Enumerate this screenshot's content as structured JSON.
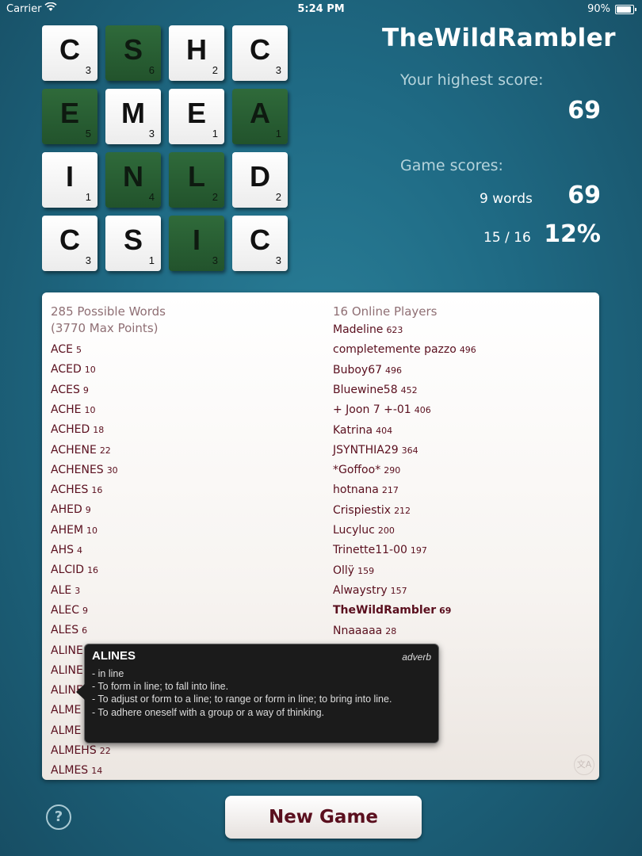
{
  "status_bar": {
    "carrier": "Carrier",
    "time": "5:24 PM",
    "battery": "90%"
  },
  "board": [
    {
      "letter": "C",
      "points": "3",
      "color": "white"
    },
    {
      "letter": "S",
      "points": "6",
      "color": "green"
    },
    {
      "letter": "H",
      "points": "2",
      "color": "white"
    },
    {
      "letter": "C",
      "points": "3",
      "color": "white"
    },
    {
      "letter": "E",
      "points": "5",
      "color": "green"
    },
    {
      "letter": "M",
      "points": "3",
      "color": "white"
    },
    {
      "letter": "E",
      "points": "1",
      "color": "white"
    },
    {
      "letter": "A",
      "points": "1",
      "color": "green"
    },
    {
      "letter": "I",
      "points": "1",
      "color": "white"
    },
    {
      "letter": "N",
      "points": "4",
      "color": "green"
    },
    {
      "letter": "L",
      "points": "2",
      "color": "green"
    },
    {
      "letter": "D",
      "points": "2",
      "color": "white"
    },
    {
      "letter": "C",
      "points": "3",
      "color": "white"
    },
    {
      "letter": "S",
      "points": "1",
      "color": "white"
    },
    {
      "letter": "I",
      "points": "3",
      "color": "green"
    },
    {
      "letter": "C",
      "points": "3",
      "color": "white"
    }
  ],
  "profile": {
    "username": "TheWildRambler",
    "highest_label": "Your highest score:",
    "highest_value": "69",
    "game_scores_label": "Game scores:",
    "words_count": "9 words",
    "game_score": "69",
    "found_ratio": "15 / 16",
    "percent": "12%"
  },
  "words_panel": {
    "title": "285 Possible Words",
    "subtitle": "(3770 Max Points)",
    "words": [
      {
        "word": "ACE",
        "points": "5"
      },
      {
        "word": "ACED",
        "points": "10"
      },
      {
        "word": "ACES",
        "points": "9"
      },
      {
        "word": "ACHE",
        "points": "10"
      },
      {
        "word": "ACHED",
        "points": "18"
      },
      {
        "word": "ACHENE",
        "points": "22"
      },
      {
        "word": "ACHENES",
        "points": "30"
      },
      {
        "word": "ACHES",
        "points": "16"
      },
      {
        "word": "AHED",
        "points": "9"
      },
      {
        "word": "AHEM",
        "points": "10"
      },
      {
        "word": "AHS",
        "points": "4"
      },
      {
        "word": "ALCID",
        "points": "16"
      },
      {
        "word": "ALE",
        "points": "3"
      },
      {
        "word": "ALEC",
        "points": "9"
      },
      {
        "word": "ALES",
        "points": "6"
      },
      {
        "word": "ALINE",
        "points": ""
      },
      {
        "word": "ALINE",
        "points": ""
      },
      {
        "word": "ALINE",
        "points": ""
      },
      {
        "word": "ALME",
        "points": ""
      },
      {
        "word": "ALME",
        "points": ""
      },
      {
        "word": "ALMEHS",
        "points": "22"
      },
      {
        "word": "ALMES",
        "points": "14"
      }
    ]
  },
  "players_panel": {
    "title": "16 Online Players",
    "players": [
      {
        "name": "Madeline",
        "score": "623"
      },
      {
        "name": "completemente pazzo",
        "score": "496"
      },
      {
        "name": "Buboy67",
        "score": "496"
      },
      {
        "name": "Bluewine58",
        "score": "452"
      },
      {
        "name": "+ Joon 7 +-01",
        "score": "406"
      },
      {
        "name": "Katrina",
        "score": "404"
      },
      {
        "name": "JSYNTHIA29",
        "score": "364"
      },
      {
        "name": "*Goffoo*",
        "score": "290"
      },
      {
        "name": "hotnana",
        "score": "217"
      },
      {
        "name": "Crispiestix",
        "score": "212"
      },
      {
        "name": "Lucyluc",
        "score": "200"
      },
      {
        "name": "Trinette11-00",
        "score": "197"
      },
      {
        "name": "Ollÿ",
        "score": "159"
      },
      {
        "name": "Alwaystry",
        "score": "157"
      },
      {
        "name": "TheWildRambler",
        "score": "69"
      },
      {
        "name": "Nnaaaaa",
        "score": "28"
      }
    ]
  },
  "definition_popup": {
    "word": "ALINES",
    "part_of_speech": "adverb",
    "lines": [
      "- in line",
      "- To form in line; to fall into line.",
      "- To adjust or form to a line; to range or form in line; to bring into line.",
      "- To adhere oneself with a group or a way of thinking."
    ]
  },
  "bottom": {
    "help_label": "?",
    "new_game_label": "New Game"
  },
  "colors": {
    "background": "#1f6a84",
    "green_tile": "#2f6a3a",
    "text_maroon": "#5a0f1e"
  },
  "icons": [
    "wifi-icon",
    "battery-icon",
    "help-icon",
    "translate-icon"
  ]
}
